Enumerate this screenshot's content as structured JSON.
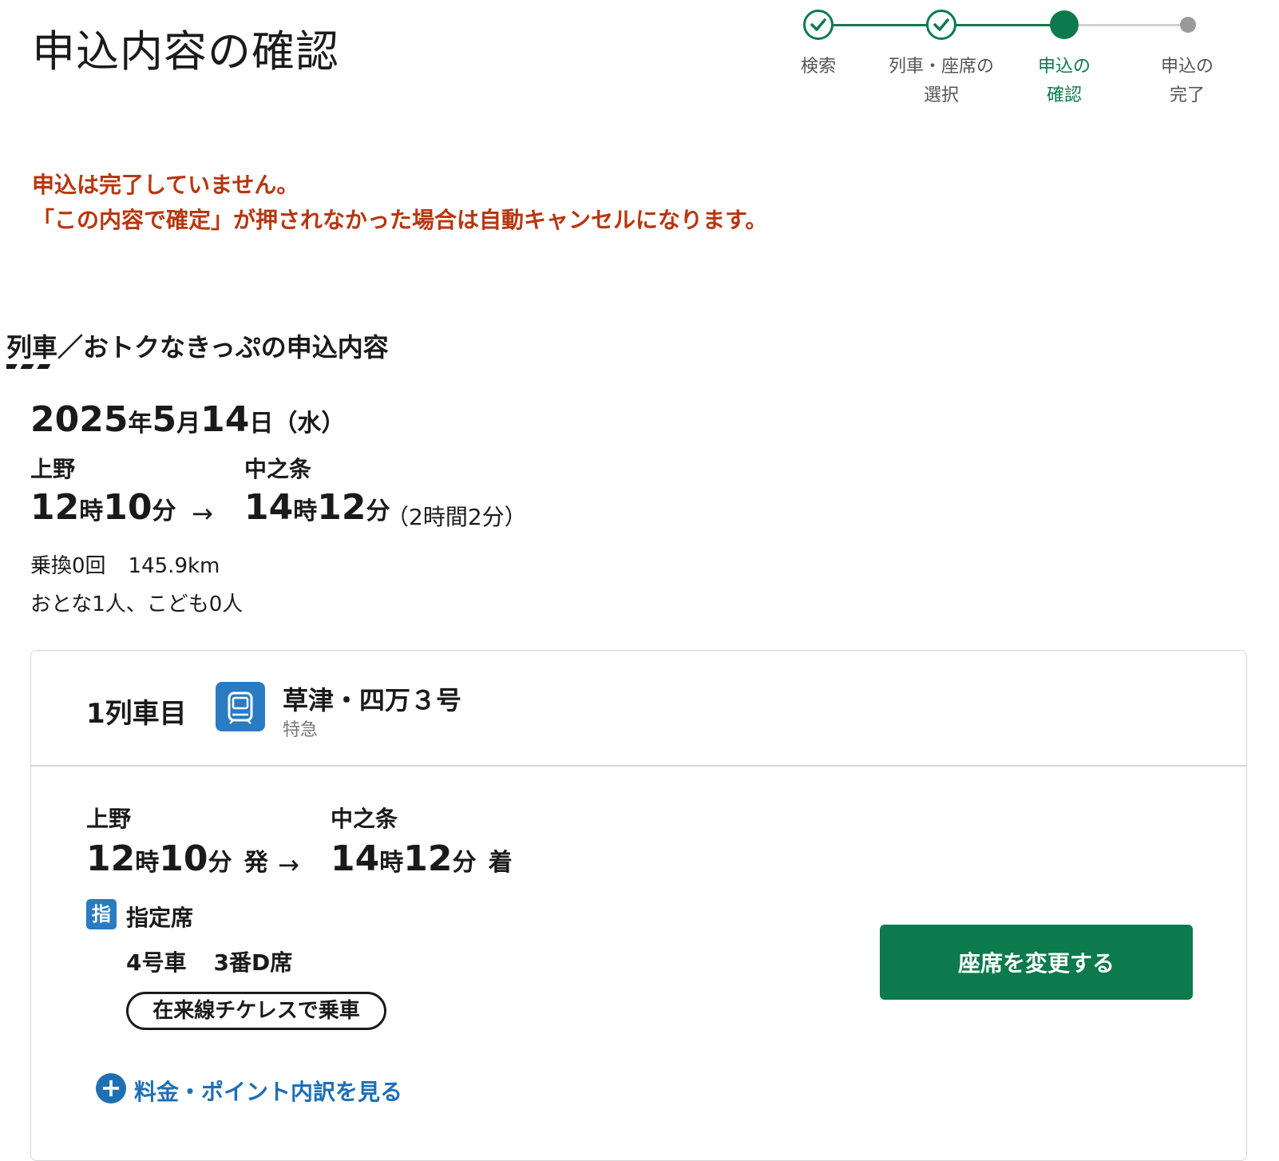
{
  "page": {
    "title": "申込内容の確認"
  },
  "stepper": {
    "steps": [
      {
        "line1": "検索",
        "line2": "",
        "state": "done"
      },
      {
        "line1": "列車・座席の",
        "line2": "選択",
        "state": "done"
      },
      {
        "line1": "申込の",
        "line2": "確認",
        "state": "current"
      },
      {
        "line1": "申込の",
        "line2": "完了",
        "state": "todo"
      }
    ],
    "colors": {
      "active": "#0c7a4c",
      "inactive": "#9a9a9a"
    }
  },
  "warning": {
    "line1": "申込は完了していません。",
    "line2": "「この内容で確定」が押されなかった場合は自動キャンセルになります。",
    "color": "#b8360f"
  },
  "section": {
    "heading": "列車／おトクなきっぷの申込内容"
  },
  "summary": {
    "date": {
      "year": "2025",
      "year_unit": "年",
      "month": "5",
      "month_unit": "月",
      "day": "14",
      "day_unit": "日",
      "weekday": "（水）"
    },
    "from_station": "上野",
    "to_station": "中之条",
    "depart": {
      "hour": "12",
      "hour_unit": "時",
      "min": "10",
      "min_unit": "分"
    },
    "arrive": {
      "hour": "14",
      "hour_unit": "時",
      "min": "12",
      "min_unit": "分"
    },
    "arrow": "→",
    "duration": "（2時間2分）",
    "transfers": "乗換0回",
    "distance": "145.9km",
    "passengers": "おとな1人、こども0人"
  },
  "train": {
    "index_label": "1列車目",
    "icon": "train-icon",
    "name": "草津・四万３号",
    "type": "特急",
    "from_station": "上野",
    "to_station": "中之条",
    "depart": {
      "hour": "12",
      "hour_unit": "時",
      "min": "10",
      "min_unit": "分",
      "suffix": "発"
    },
    "arrive": {
      "hour": "14",
      "hour_unit": "時",
      "min": "12",
      "min_unit": "分",
      "suffix": "着"
    },
    "arrow": "→",
    "seat_badge": "指",
    "seat_kind": "指定席",
    "car": "4号車",
    "seat": "3番D席",
    "ticketless": "在来線チケレスで乗車",
    "change_seat_button": "座席を変更する",
    "fare_toggle_icon": "+",
    "fare_link": "料金・ポイント内訳を見る",
    "colors": {
      "icon_bg": "#2a7bc1",
      "button_bg": "#0c7a4c",
      "link": "#1f6fb3"
    }
  }
}
